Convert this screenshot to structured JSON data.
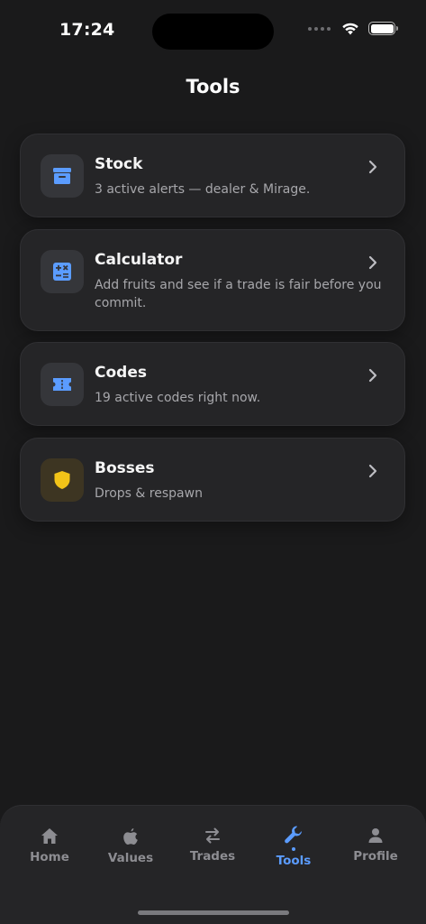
{
  "status": {
    "time": "17:24"
  },
  "page": {
    "title": "Tools"
  },
  "cards": [
    {
      "title": "Stock",
      "subtitle": "3 active alerts — dealer & Mirage.",
      "icon": "archive-box-icon",
      "icon_color": "#5b9cff"
    },
    {
      "title": "Calculator",
      "subtitle": "Add fruits and see if a trade is fair before you commit.",
      "icon": "calculator-icon",
      "icon_color": "#5b9cff"
    },
    {
      "title": "Codes",
      "subtitle": "19 active codes right now.",
      "icon": "ticket-icon",
      "icon_color": "#5b9cff"
    },
    {
      "title": "Bosses",
      "subtitle": "Drops & respawn",
      "icon": "shield-icon",
      "icon_color": "#f2c318"
    }
  ],
  "tabs": [
    {
      "label": "Home",
      "icon": "home-icon"
    },
    {
      "label": "Values",
      "icon": "apple-icon"
    },
    {
      "label": "Trades",
      "icon": "swap-arrows-icon"
    },
    {
      "label": "Tools",
      "icon": "wrench-icon",
      "active": true
    },
    {
      "label": "Profile",
      "icon": "person-icon"
    }
  ],
  "colors": {
    "accent": "#5b9cff",
    "background": "#1a1a1b",
    "card": "#252527",
    "boss_accent": "#f2c318"
  }
}
